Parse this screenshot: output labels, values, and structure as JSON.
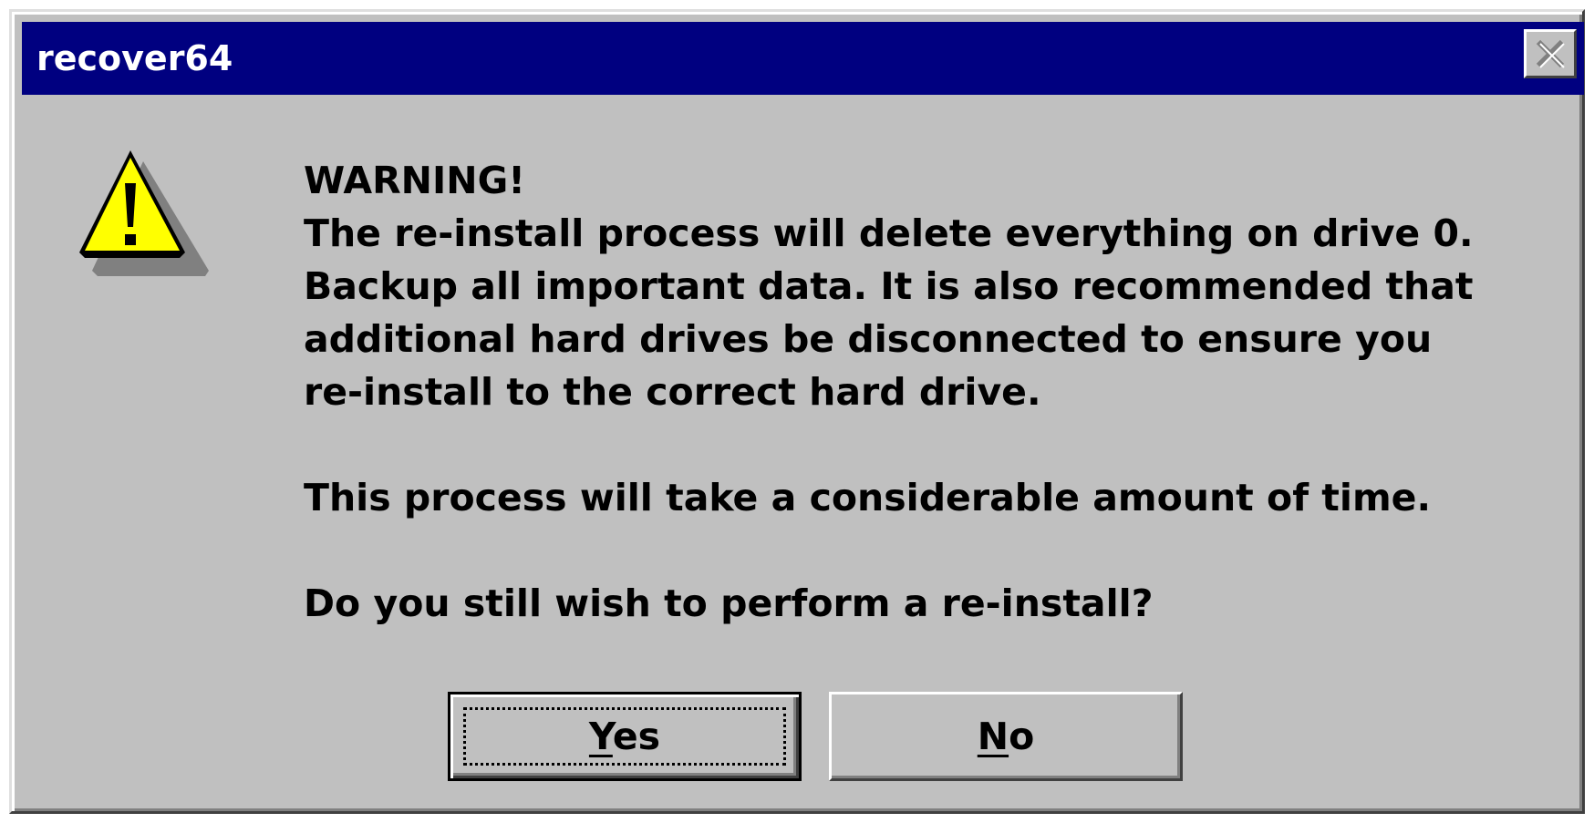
{
  "window": {
    "title": "recover64",
    "close_icon": "close-icon"
  },
  "icon": "warning-icon",
  "message": {
    "heading": "WARNING!",
    "lines": [
      "The re-install process will delete everything on drive 0.",
      "Backup all important data. It is also recommended that",
      "additional hard drives be disconnected to ensure you",
      "re-install to the correct hard drive."
    ],
    "time_notice": "This process will take a considerable amount of time.",
    "question": "Do you still wish to perform a re-install?"
  },
  "buttons": {
    "yes": {
      "mnemonic": "Y",
      "rest": "es"
    },
    "no": {
      "mnemonic": "N",
      "rest": "o"
    }
  },
  "colors": {
    "titlebar": "#000080",
    "face": "#c0c0c0",
    "warning_fill": "#ffff00"
  }
}
